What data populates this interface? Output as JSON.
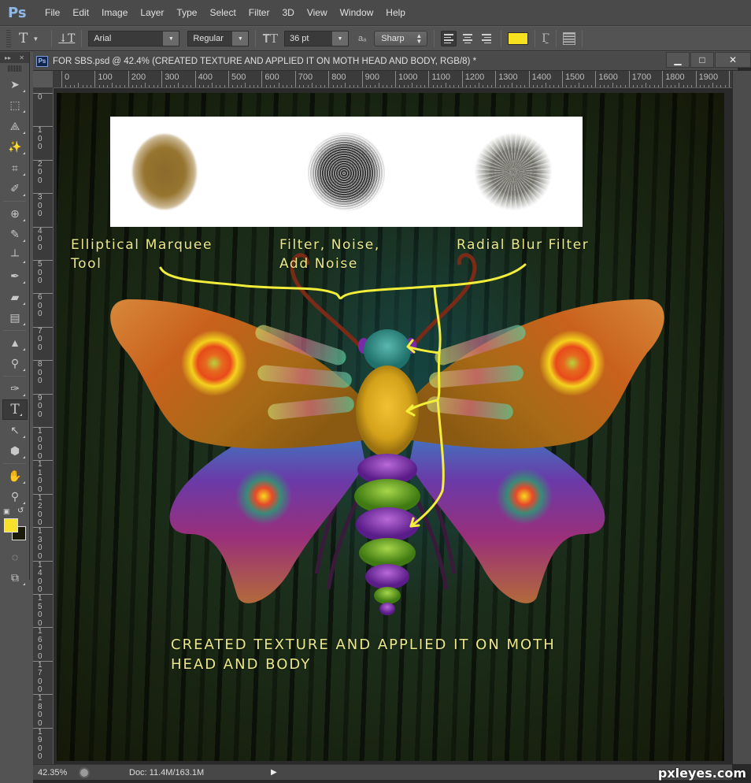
{
  "app": {
    "logo": "Ps",
    "menu": [
      "File",
      "Edit",
      "Image",
      "Layer",
      "Type",
      "Select",
      "Filter",
      "3D",
      "View",
      "Window",
      "Help"
    ]
  },
  "options_bar": {
    "tool_icon": "type-tool-icon",
    "orientation_icon": "toggle-text-orientation-icon",
    "font_family": "Arial",
    "font_style": "Regular",
    "size_icon": "font-size-icon",
    "font_size": "36 pt",
    "antialias_icon_text": "aₐ",
    "antialias": "Sharp",
    "alignment": [
      "left",
      "center",
      "right"
    ],
    "alignment_active": "left",
    "text_color": "#f5e11e"
  },
  "toolbox": {
    "header_expand": "▸▸",
    "header_close": "✕",
    "tools": [
      {
        "name": "move-tool",
        "glyph": "➤"
      },
      {
        "name": "rectangular-marquee-tool",
        "glyph": "⬚"
      },
      {
        "name": "lasso-tool",
        "glyph": "⟁"
      },
      {
        "name": "magic-wand-tool",
        "glyph": "✨"
      },
      {
        "name": "crop-tool",
        "glyph": "⌗"
      },
      {
        "name": "eyedropper-tool",
        "glyph": "✐"
      },
      {
        "name": "healing-brush-tool",
        "glyph": "⊕"
      },
      {
        "name": "brush-tool",
        "glyph": "✎"
      },
      {
        "name": "clone-stamp-tool",
        "glyph": "┴"
      },
      {
        "name": "history-brush-tool",
        "glyph": "✒"
      },
      {
        "name": "eraser-tool",
        "glyph": "▰"
      },
      {
        "name": "gradient-tool",
        "glyph": "▤"
      },
      {
        "name": "blur-tool",
        "glyph": "▲"
      },
      {
        "name": "dodge-tool",
        "glyph": "⚲"
      },
      {
        "name": "pen-tool",
        "glyph": "✑"
      },
      {
        "name": "type-tool",
        "glyph": "T"
      },
      {
        "name": "path-selection-tool",
        "glyph": "↖"
      },
      {
        "name": "shape-tool",
        "glyph": "⬢"
      },
      {
        "name": "hand-tool",
        "glyph": "✋"
      },
      {
        "name": "zoom-tool",
        "glyph": "⚲"
      }
    ],
    "active_tool": "type-tool",
    "foreground_color": "#f7e12a",
    "background_color": "#1c1a08",
    "quick_mask_glyph": "◌",
    "screen_mode_glyph": "⧉"
  },
  "document": {
    "badge": "Ps",
    "title": "FOR SBS.psd @ 42.4% (CREATED TEXTURE AND APPLIED IT ON MOTH HEAD AND BODY, RGB/8) *",
    "window_controls": {
      "minimize": "▁",
      "maximize": "□",
      "close": "✕"
    },
    "h_ruler_labels": [
      "0",
      "100",
      "200",
      "300",
      "400",
      "500",
      "600",
      "700",
      "800",
      "900",
      "1000",
      "1100",
      "1200",
      "1300",
      "1400",
      "1500",
      "1600",
      "1700",
      "1800",
      "1900",
      "2"
    ],
    "v_ruler_labels": [
      "0",
      "100",
      "200",
      "300",
      "400",
      "500",
      "600",
      "700",
      "800",
      "900",
      "1000",
      "1100",
      "1200",
      "1300",
      "1400",
      "1500",
      "1600",
      "1700",
      "1800",
      "1900"
    ]
  },
  "artwork": {
    "labels": {
      "marquee": "Elliptical Marquee\nTool",
      "noise": "Filter, Noise,\nAdd Noise",
      "radial": "Radial Blur Filter"
    },
    "caption": "CREATED TEXTURE AND APPLIED IT ON MOTH\nHEAD AND BODY",
    "annotation_color": "#f3ee3a",
    "samples": [
      "elliptical-marquee-blob",
      "add-noise-blob",
      "radial-blur-blob"
    ]
  },
  "status_bar": {
    "zoom": "42.35%",
    "doc_size": "Doc: 11.4M/163.1M",
    "arrow": "▶"
  },
  "watermark": "pxleyes.com"
}
